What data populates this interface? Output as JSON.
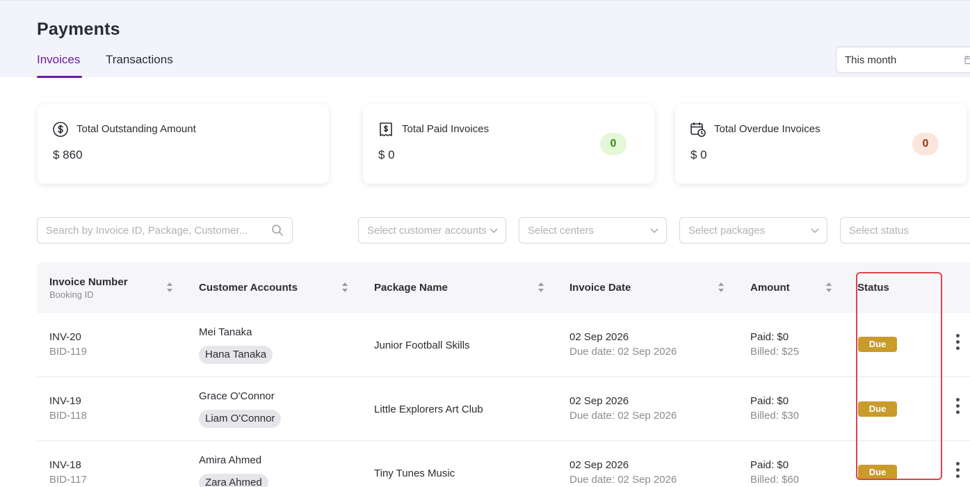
{
  "page": {
    "title": "Payments"
  },
  "tabs": [
    {
      "label": "Invoices",
      "active": true
    },
    {
      "label": "Transactions",
      "active": false
    }
  ],
  "date_filter": {
    "value": "This month",
    "icon": "calendar-icon"
  },
  "summary_cards": [
    {
      "label": "Total Outstanding Amount",
      "value": "$ 860",
      "icon": "dollar-circle-icon"
    },
    {
      "label": "Total Paid Invoices",
      "value": "$ 0",
      "badge": "0",
      "badge_color": "#e3f8d6",
      "badge_text_color": "#3a8a1c",
      "icon": "paid-invoice-icon"
    },
    {
      "label": "Total Overdue Invoices",
      "value": "$ 0",
      "badge": "0",
      "badge_color": "#fbe6dc",
      "badge_text_color": "#8a3a1a",
      "icon": "calendar-clock-icon"
    }
  ],
  "filters": {
    "search_placeholder": "Search by Invoice ID, Package, Customer...",
    "customer_accounts": "Select customer accounts",
    "centers": "Select centers",
    "packages": "Select packages",
    "status": "Select status"
  },
  "table": {
    "columns": {
      "invoice_number": "Invoice Number",
      "booking_id": "Booking ID",
      "customer_accounts": "Customer Accounts",
      "package_name": "Package Name",
      "invoice_date": "Invoice Date",
      "amount": "Amount",
      "status": "Status"
    },
    "rows": [
      {
        "invoice": "INV-20",
        "booking": "BID-119",
        "customer": "Mei Tanaka",
        "child": "Hana Tanaka",
        "package": "Junior Football Skills",
        "date": "02 Sep 2026",
        "due": "Due date: 02 Sep 2026",
        "paid": "Paid: $0",
        "billed": "Billed: $25",
        "status": "Due"
      },
      {
        "invoice": "INV-19",
        "booking": "BID-118",
        "customer": "Grace O'Connor",
        "child": "Liam O'Connor",
        "package": "Little Explorers Art Club",
        "date": "02 Sep 2026",
        "due": "Due date: 02 Sep 2026",
        "paid": "Paid: $0",
        "billed": "Billed: $30",
        "status": "Due"
      },
      {
        "invoice": "INV-18",
        "booking": "BID-117",
        "customer": "Amira Ahmed",
        "child": "Zara Ahmed",
        "package": "Tiny Tunes Music",
        "date": "02 Sep 2026",
        "due": "Due date: 02 Sep 2026",
        "paid": "Paid: $0",
        "billed": "Billed: $60",
        "status": "Due"
      }
    ]
  },
  "colors": {
    "accent": "#6a1b9a",
    "status_due": "#c89b2b",
    "highlight": "#d9454f",
    "header_bg": "#f3f4fb"
  }
}
